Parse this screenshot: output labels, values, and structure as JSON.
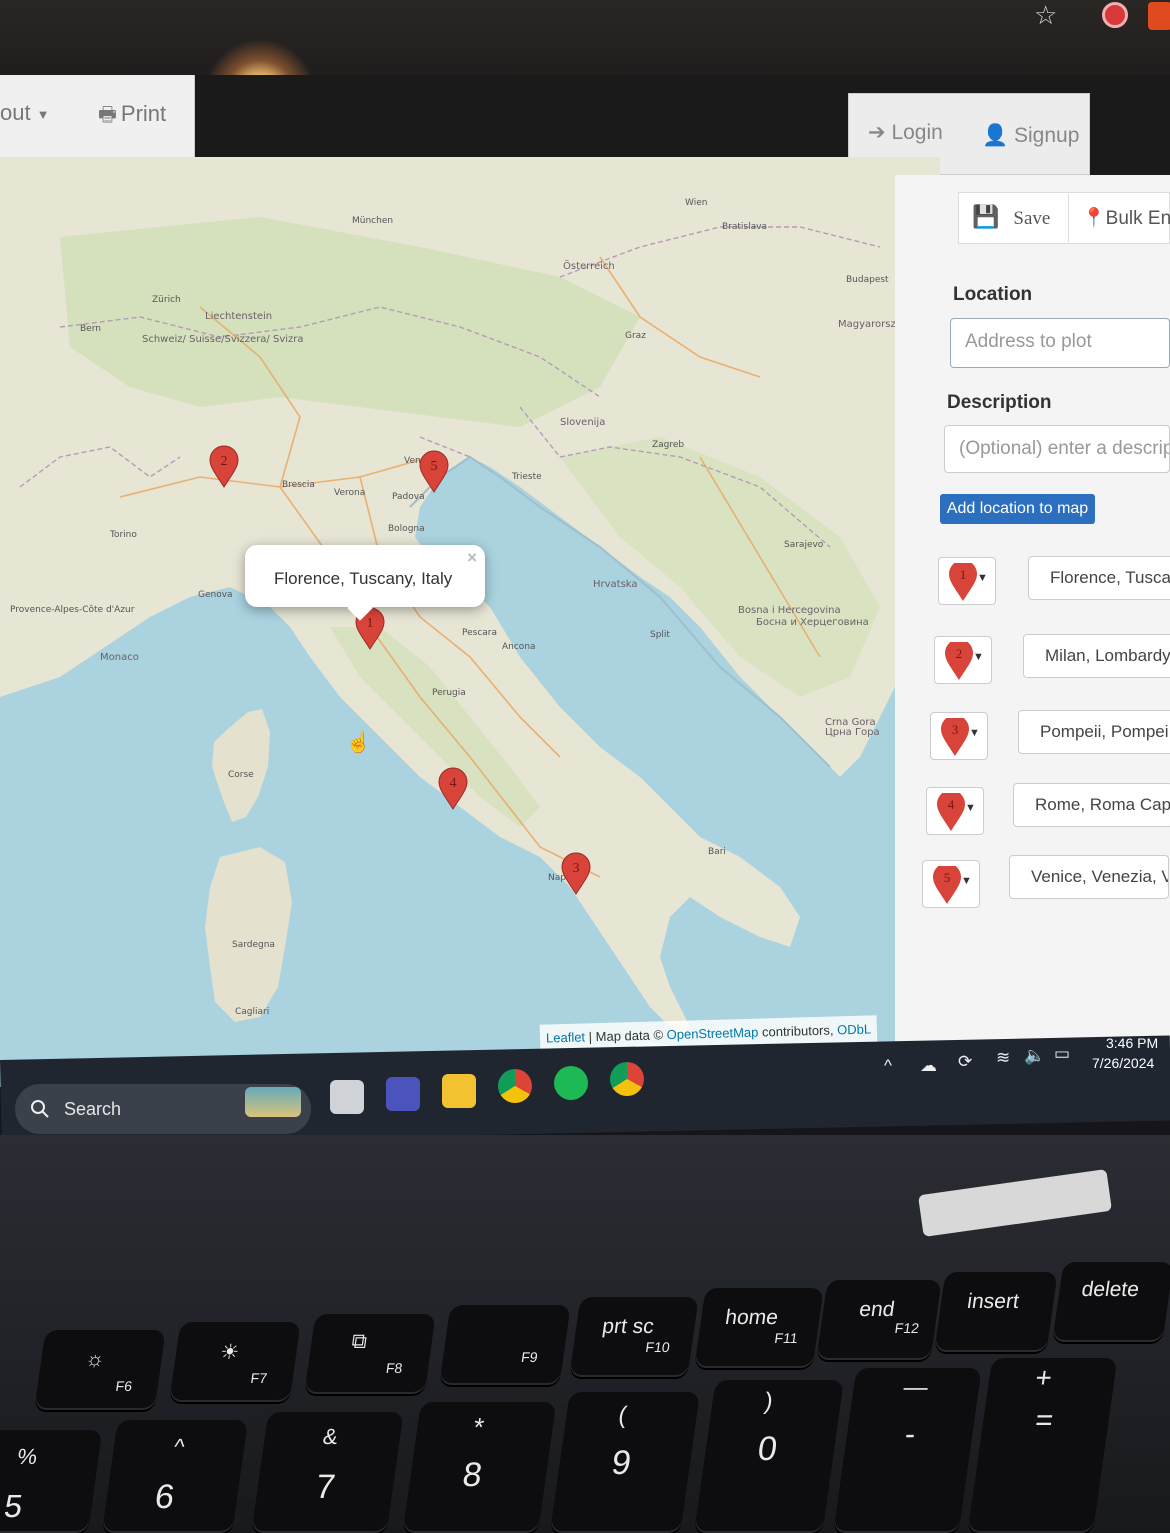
{
  "header": {
    "layout_label": "out",
    "print_label": "Print",
    "login_label": "Login",
    "signup_label": "Signup"
  },
  "sidebar": {
    "save_label": "Save",
    "bulk_label": "Bulk En",
    "location_label": "Location",
    "location_placeholder": "Address to plot",
    "description_label": "Description",
    "description_placeholder": "(Optional) enter a descrip",
    "add_button_label": "Add location to map",
    "locations": [
      {
        "number": "1",
        "name": "Florence, Tusca"
      },
      {
        "number": "2",
        "name": "Milan, Lombardy"
      },
      {
        "number": "3",
        "name": "Pompeii, Pompei"
      },
      {
        "number": "4",
        "name": "Rome, Roma Cap"
      },
      {
        "number": "5",
        "name": "Venice, Venezia, V"
      }
    ]
  },
  "map": {
    "popup_text": "Florence, Tuscany, Italy",
    "popup_close": "×",
    "attribution_leaflet": "Leaflet",
    "attribution_mapdata": " | Map data © ",
    "attribution_osm": "OpenStreetMap",
    "attribution_contrib": " contributors, ",
    "attribution_odbl": "ODbL",
    "marker_color": "#d9443a",
    "labels": {
      "osterreich": "Österreich",
      "schweiz": "Schweiz/ Suisse/Svizzera/ Svizra",
      "liechtenstein": "Liechtenstein",
      "slovenija": "Slovenija",
      "hrvatska": "Hrvatska",
      "magyarorszag": "Magyarország",
      "bosna": "Bosna i Hercegovina",
      "bosna2": "Босна и Херцеговина",
      "crna_gora": "Crna Gora",
      "crna_gora2": "Црна Гора",
      "monaco": "Monaco",
      "munchen": "München",
      "zurich": "Zürich",
      "bern": "Bern",
      "torino": "Torino",
      "genova": "Genova",
      "trieste": "Trieste",
      "zagreb": "Zagreb",
      "budapest": "Budapest",
      "bratislava": "Bratislava",
      "wien": "Wien",
      "napoli": "Napoli",
      "bari": "Bari",
      "pescara": "Pescara",
      "ancona": "Ancona",
      "split": "Split",
      "sarajevo": "Sarajevo",
      "graz": "Graz",
      "venezia": "Venezia",
      "bologna": "Bologna",
      "perugia": "Perugia",
      "corsica": "Corse",
      "sardegna": "Sardegna",
      "cagliari": "Cagliari",
      "brescia": "Brescia",
      "verona": "Verona",
      "padova": "Padova",
      "provence": "Provence-Alpes-Côte d'Azur"
    }
  },
  "taskbar": {
    "search_label": "Search",
    "time": "3:46 PM",
    "date": "7/26/2024"
  },
  "keyboard": {
    "fn_row": [
      {
        "main": "☼",
        "sub": "F6"
      },
      {
        "main": "☀",
        "sub": "F7"
      },
      {
        "main": "⧉",
        "sub": "F8"
      },
      {
        "main": "",
        "sub": "F9"
      },
      {
        "main": "prt sc",
        "sub": "F10"
      },
      {
        "main": "home",
        "sub": "F11"
      },
      {
        "main": "end",
        "sub": "F12"
      },
      {
        "main": "insert",
        "sub": ""
      },
      {
        "main": "delete",
        "sub": ""
      }
    ],
    "num_row": [
      {
        "main": "5",
        "sub": "%"
      },
      {
        "main": "6",
        "sub": "^"
      },
      {
        "main": "7",
        "sub": "&"
      },
      {
        "main": "8",
        "sub": "*"
      },
      {
        "main": "9",
        "sub": "("
      },
      {
        "main": "0",
        "sub": ")"
      },
      {
        "main": "-",
        "sub": "—"
      },
      {
        "main": "=",
        "sub": "+"
      }
    ]
  }
}
